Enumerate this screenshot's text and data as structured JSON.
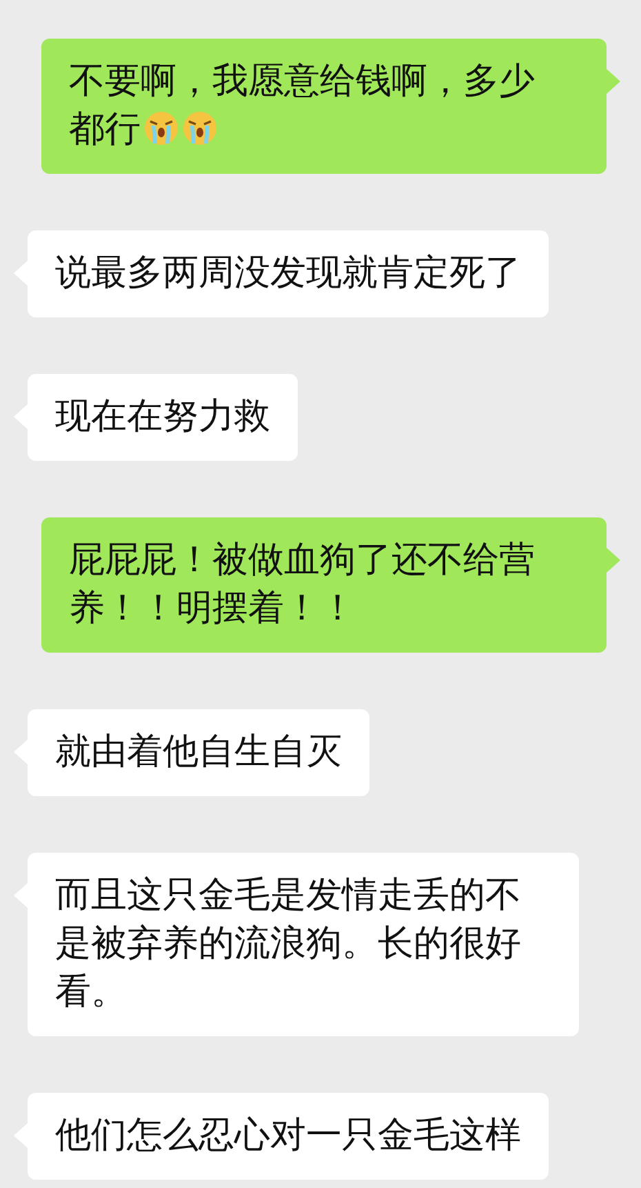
{
  "messages": [
    {
      "kind": "sent",
      "text": "不要啊，我愿意给钱啊，多少都行",
      "emojis": [
        {
          "kind": "crying"
        },
        {
          "kind": "crying"
        }
      ]
    },
    {
      "kind": "received",
      "text": "说最多两周没发现就肯定死了"
    },
    {
      "kind": "received",
      "text": "现在在努力救"
    },
    {
      "kind": "sent",
      "text": "屁屁屁！被做血狗了还不给营养！！明摆着！！"
    },
    {
      "kind": "received",
      "text": "就由着他自生自灭"
    },
    {
      "kind": "received",
      "text": "而且这只金毛是发情走丢的不是被弃养的流浪狗。长的很好看。"
    },
    {
      "kind": "received",
      "text": "他们怎么忍心对一只金毛这样"
    }
  ]
}
